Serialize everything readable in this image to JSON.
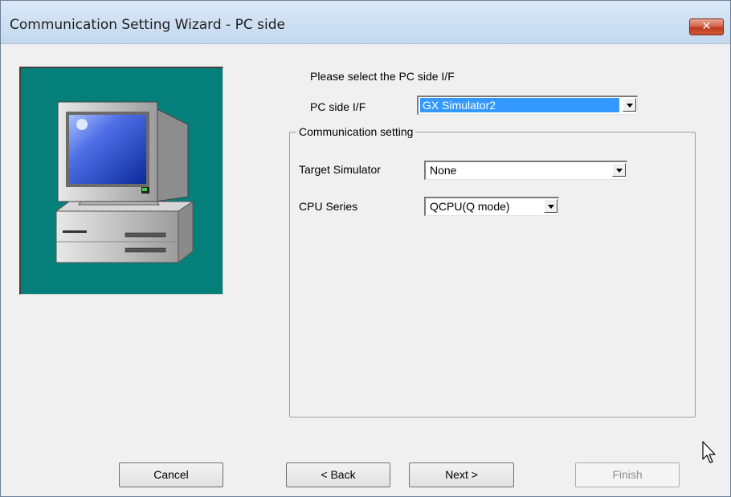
{
  "window": {
    "title": "Communication Setting Wizard - PC side",
    "close_glyph": "✕"
  },
  "form": {
    "prompt": "Please select the PC side I/F",
    "pc_side_if_label": "PC side I/F",
    "pc_side_if_value": "GX Simulator2",
    "group_title": "Communication setting",
    "target_simulator_label": "Target Simulator",
    "target_simulator_value": "None",
    "cpu_series_label": "CPU Series",
    "cpu_series_value": "QCPU(Q mode)"
  },
  "buttons": {
    "cancel": "Cancel",
    "back": "< Back",
    "next": "Next >",
    "finish": "Finish"
  },
  "icons": {
    "illustration": "computer-monitor-icon",
    "dropdown": "chevron-down-icon",
    "cursor": "mouse-pointer-icon"
  },
  "colors": {
    "illustration_bg": "#057f7a",
    "selection": "#3399ff",
    "close_button": "#c03a20"
  }
}
